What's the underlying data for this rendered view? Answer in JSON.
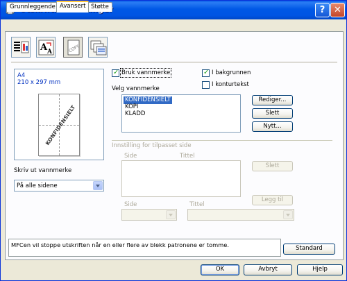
{
  "window": {
    "title": "Utskriftsinnstillinger",
    "help_glyph": "?",
    "close_glyph": "✕",
    "title_bar_color": "#0054e3"
  },
  "tabs": [
    {
      "label": "Grunnleggende",
      "active": false
    },
    {
      "label": "Avansert",
      "active": true
    },
    {
      "label": "Støtte",
      "active": false
    }
  ],
  "toolbar": {
    "icons": [
      "print-quality-icon",
      "font-scaling-icon",
      "watermark-copy-icon",
      "page-options-icon"
    ],
    "watermark_stamp_text": "COPY"
  },
  "preview": {
    "paper": "A4",
    "dimensions": "210 x 297 mm",
    "watermark_text": "KONFIDENSIELT"
  },
  "print_watermark": {
    "label": "Skriv ut vannmerke",
    "selected": "På alle sidene"
  },
  "options": {
    "use_watermark": {
      "label": "Bruk vannmerke",
      "checked": true
    },
    "in_background": {
      "label": "I bakgrunnen",
      "checked": true
    },
    "outline_text": {
      "label": "I konturtekst",
      "checked": false
    }
  },
  "watermark_list": {
    "label": "Velg vannmerke",
    "items": [
      "KONFIDENSIELT",
      "KOPI",
      "KLADD"
    ],
    "selected_index": 0
  },
  "buttons": {
    "edit": "Rediger...",
    "delete": "Slett",
    "new": "Nytt..."
  },
  "custom_page": {
    "header": "Innstilling for tilpasset side",
    "col_page": "Side",
    "col_title": "Tittel",
    "delete": "Slett",
    "page_label": "Side",
    "title_label": "Tittel",
    "add": "Legg til"
  },
  "status_text": "MFCen vil stoppe utskriften når en eller flere av blekk patronene er tomme.",
  "footer": {
    "standard": "Standard",
    "ok": "OK",
    "cancel": "Avbryt",
    "help": "Hjelp"
  }
}
